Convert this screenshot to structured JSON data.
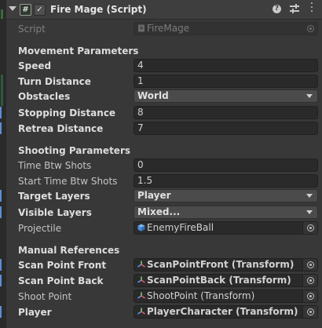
{
  "header": {
    "title": "Fire Mage (Script)",
    "script_icon_glyph": "#",
    "check_glyph": "✓",
    "help_glyph": "?"
  },
  "script_row": {
    "label": "Script",
    "value": "FireMage"
  },
  "movement": {
    "title": "Movement Parameters",
    "rows": [
      {
        "label": "Speed",
        "value": "4"
      },
      {
        "label": "Turn Distance",
        "value": "1"
      },
      {
        "label": "Obstacles",
        "value": "World"
      },
      {
        "label": "Stopping Distance",
        "value": "8"
      },
      {
        "label": "Retrea Distance",
        "value": "7"
      }
    ]
  },
  "shooting": {
    "title": "Shooting Parameters",
    "rows": [
      {
        "label": "Time Btw Shots",
        "value": "0"
      },
      {
        "label": "Start Time Btw Shots",
        "value": "1.5"
      },
      {
        "label": "Target Layers",
        "value": "Player"
      },
      {
        "label": "Visible Layers",
        "value": "Mixed..."
      },
      {
        "label": "Projectile",
        "value": "EnemyFireBall"
      }
    ]
  },
  "manual": {
    "title": "Manual References",
    "rows": [
      {
        "label": "Scan Point Front",
        "value": "ScanPointFront (Transform)"
      },
      {
        "label": "Scan Point Back",
        "value": "ScanPointBack (Transform)"
      },
      {
        "label": "Shoot Point",
        "value": "ShootPoint (Transform)"
      },
      {
        "label": "Player",
        "value": "PlayerCharacter  (Transform)"
      }
    ]
  },
  "colors": {
    "background": "#383838",
    "field": "#2a2a2a",
    "dropdown": "#4b4b4b",
    "modified_marker": "#5a8ed6"
  },
  "icons": {
    "script_field": "script-asset-icon",
    "projectile": "prefab-cube-icon",
    "transform": "transform-axes-icon",
    "picker": "object-picker-icon"
  }
}
